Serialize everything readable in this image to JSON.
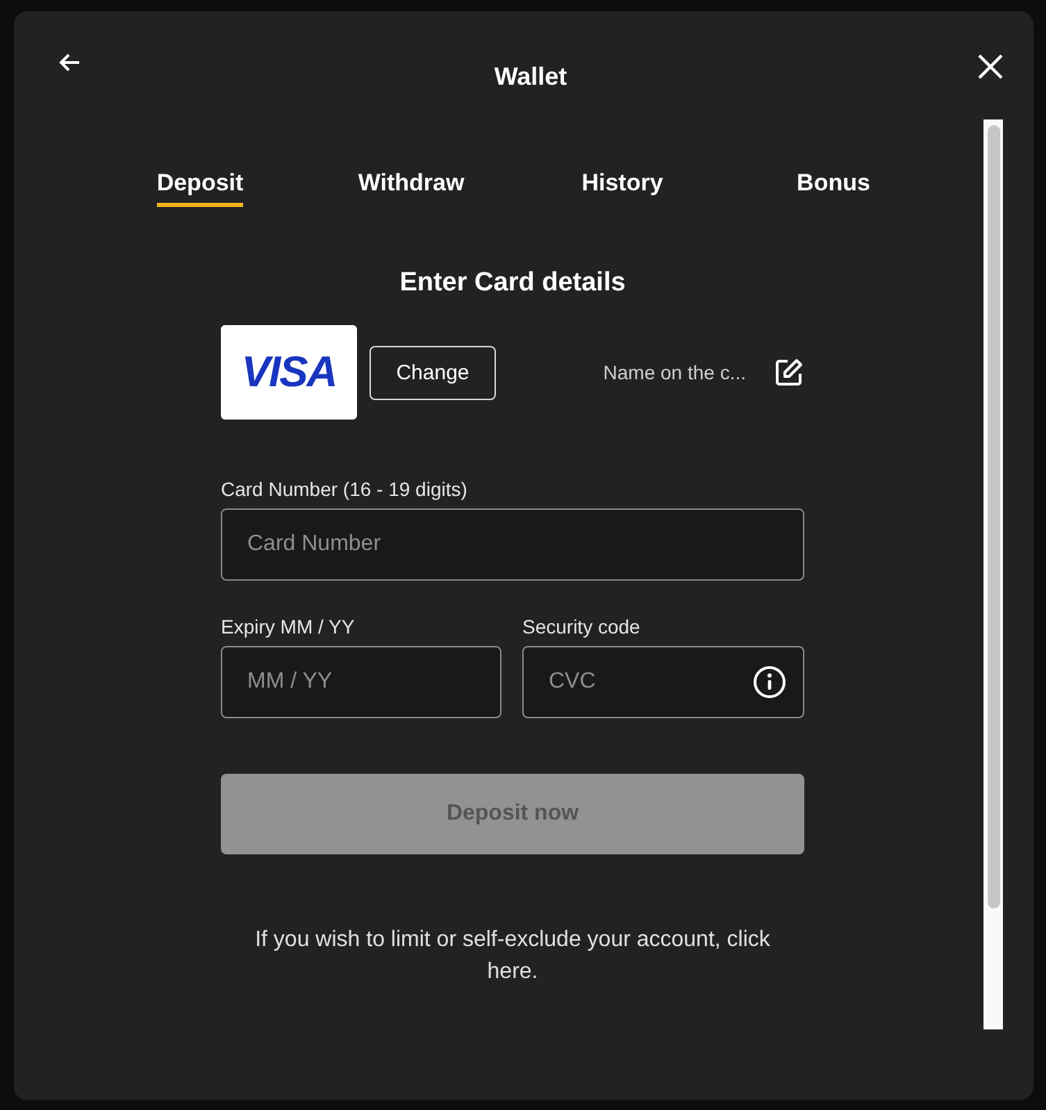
{
  "window": {
    "title": "Wallet"
  },
  "tabs": [
    {
      "label": "Deposit",
      "selected": true
    },
    {
      "label": "Withdraw",
      "selected": false
    },
    {
      "label": "History",
      "selected": false
    },
    {
      "label": "Bonus",
      "selected": false
    }
  ],
  "form": {
    "heading": "Enter Card details",
    "card_brand": "VISA",
    "change_button": "Change",
    "name_on_card": "Name on the c...",
    "fields": [
      {
        "label": "Card Number (16 - 19 digits)",
        "placeholder": "Card Number",
        "kind": "plain"
      },
      {
        "label": "Expiry MM / YY",
        "placeholder": "MM / YY",
        "kind": "plain"
      },
      {
        "label": "Security code",
        "placeholder": "CVC",
        "kind": "info"
      }
    ],
    "submit": {
      "label": "Deposit now",
      "disabled": true
    }
  },
  "footer_note": "If you wish to limit or self-exclude your account, click here."
}
